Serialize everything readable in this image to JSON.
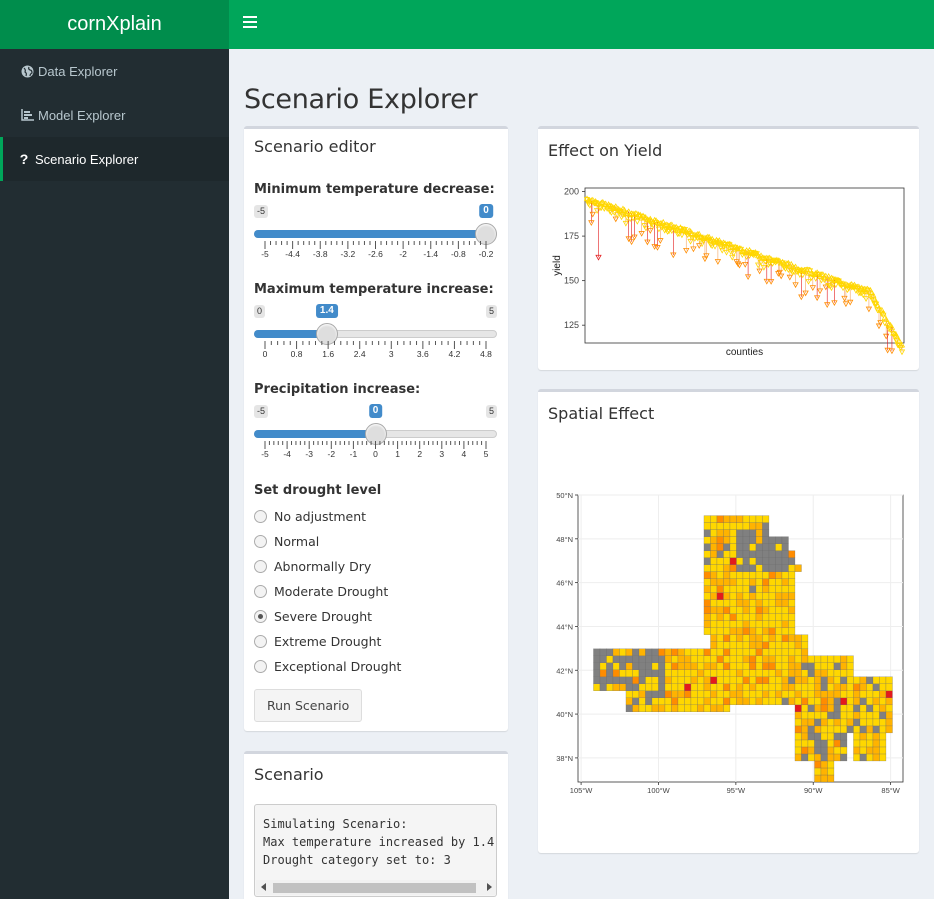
{
  "app": {
    "title": "cornXplain"
  },
  "sidebar": {
    "items": [
      {
        "label": "Data Explorer",
        "icon": "globe-icon"
      },
      {
        "label": "Model Explorer",
        "icon": "bar-chart-icon"
      },
      {
        "label": "Scenario Explorer",
        "icon": "question-icon",
        "active": true
      }
    ]
  },
  "page": {
    "title": "Scenario Explorer"
  },
  "editor": {
    "title": "Scenario editor",
    "min_temp": {
      "label": "Minimum temperature decrease:",
      "min": "-5",
      "value": "0",
      "min_num": -5,
      "max_num": 0,
      "value_num": 0,
      "ticks": [
        "-5",
        "-4.4",
        "-3.8",
        "-3.2",
        "-2.6",
        "-2",
        "-1.4",
        "-0.8",
        "-0.2"
      ]
    },
    "max_temp": {
      "label": "Maximum temperature increase:",
      "min": "0",
      "max": "5",
      "value": "1.4",
      "min_num": 0,
      "max_num": 5,
      "value_num": 1.4,
      "ticks": [
        "0",
        "0.8",
        "1.6",
        "2.4",
        "3",
        "3.6",
        "4.2",
        "4.8"
      ]
    },
    "precip": {
      "label": "Precipitation increase:",
      "min": "-5",
      "max": "5",
      "value": "0",
      "min_num": -5,
      "max_num": 5,
      "value_num": 0,
      "ticks": [
        "-5",
        "-4",
        "-3",
        "-2",
        "-1",
        "0",
        "1",
        "2",
        "3",
        "4",
        "5"
      ]
    },
    "drought": {
      "label": "Set drought level",
      "options": [
        "No adjustment",
        "Normal",
        "Abnormally Dry",
        "Moderate Drought",
        "Severe Drought",
        "Extreme Drought",
        "Exceptional Drought"
      ],
      "selected": "Severe Drought"
    },
    "run_button": "Run Scenario"
  },
  "scenario": {
    "title": "Scenario",
    "lines": [
      "Simulating Scenario:",
      "Max temperature increased by 1.4",
      "Drought category set to: 3"
    ]
  },
  "yield_box": {
    "title": "Effect on Yield"
  },
  "spatial_box": {
    "title": "Spatial Effect"
  },
  "chart_data": [
    {
      "type": "scatter",
      "xlabel": "counties",
      "ylabel": "yield",
      "ylim": [
        115,
        202
      ],
      "yticks": [
        "125",
        "150",
        "175",
        "200"
      ],
      "series": [
        {
          "values_note": "baseline sorted descending",
          "start": 196,
          "end": 118
        }
      ],
      "colors": {
        "baseline": "#ffd700",
        "scenario": "#ff8c00",
        "drop_line": "#e31a1c"
      }
    },
    {
      "type": "heatmap",
      "x_ticks": [
        "105°W",
        "100°W",
        "95°W",
        "90°W",
        "85°W"
      ],
      "y_ticks": [
        "38°N",
        "40°N",
        "42°N",
        "44°N",
        "46°N",
        "48°N",
        "50°N"
      ],
      "colors": {
        "low": "#ffd700",
        "mid": "#ff8c00",
        "high": "#e31a1c",
        "na": "#808080"
      }
    }
  ]
}
